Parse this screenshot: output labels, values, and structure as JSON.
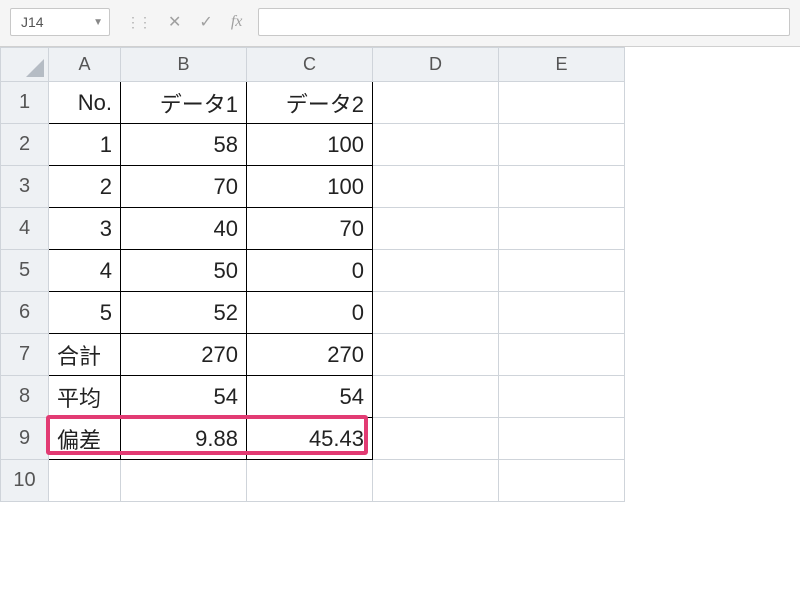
{
  "name_box": "J14",
  "formula_value": "",
  "column_headers": [
    "A",
    "B",
    "C",
    "D",
    "E"
  ],
  "row_headers": [
    "1",
    "2",
    "3",
    "4",
    "5",
    "6",
    "7",
    "8",
    "9",
    "10"
  ],
  "header_row": {
    "a": "No.",
    "b": "データ1",
    "c": "データ2"
  },
  "rows": [
    {
      "no": "1",
      "d1": "58",
      "d2": "100"
    },
    {
      "no": "2",
      "d1": "70",
      "d2": "100"
    },
    {
      "no": "3",
      "d1": "40",
      "d2": "70"
    },
    {
      "no": "4",
      "d1": "50",
      "d2": "0"
    },
    {
      "no": "5",
      "d1": "52",
      "d2": "0"
    }
  ],
  "summary": {
    "total_label": "合計",
    "total_d1": "270",
    "total_d2": "270",
    "avg_label": "平均",
    "avg_d1": "54",
    "avg_d2": "54",
    "dev_label": "偏差",
    "dev_d1": "9.88",
    "dev_d2": "45.43"
  },
  "chart_data": {
    "type": "table",
    "title": "",
    "columns": [
      "No.",
      "データ1",
      "データ2"
    ],
    "rows": [
      [
        "1",
        58,
        100
      ],
      [
        "2",
        70,
        100
      ],
      [
        "3",
        40,
        70
      ],
      [
        "4",
        50,
        0
      ],
      [
        "5",
        52,
        0
      ],
      [
        "合計",
        270,
        270
      ],
      [
        "平均",
        54,
        54
      ],
      [
        "偏差",
        9.88,
        45.43
      ]
    ]
  },
  "fx_label": "fx"
}
